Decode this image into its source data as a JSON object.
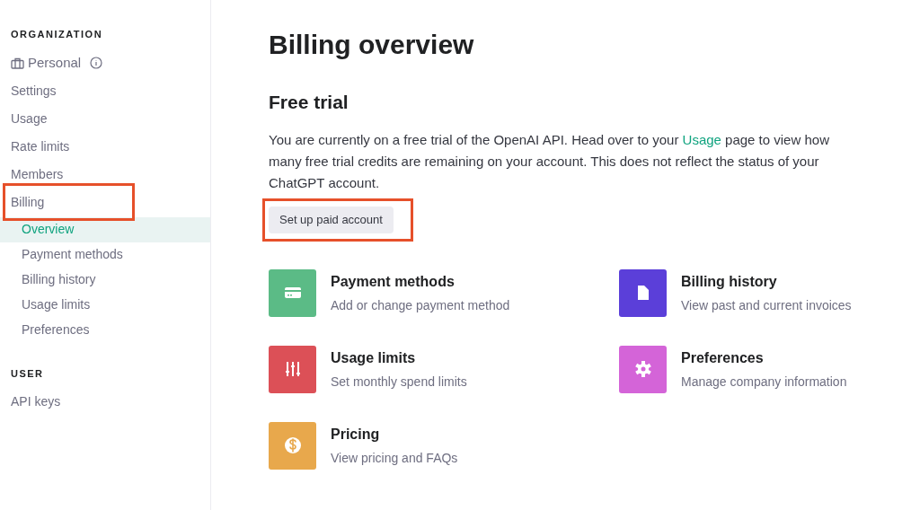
{
  "sidebar": {
    "sections": [
      {
        "heading": "ORGANIZATION",
        "items": [
          {
            "label": "Personal",
            "kind": "org"
          },
          {
            "label": "Settings",
            "kind": "link",
            "selected": false,
            "highlighted": false
          },
          {
            "label": "Usage",
            "kind": "link",
            "selected": false,
            "highlighted": false
          },
          {
            "label": "Rate limits",
            "kind": "link",
            "selected": false,
            "highlighted": false
          },
          {
            "label": "Members",
            "kind": "link",
            "selected": false,
            "highlighted": false
          },
          {
            "label": "Billing",
            "kind": "link",
            "selected": false,
            "highlighted": true,
            "children": [
              {
                "label": "Overview",
                "selected": true
              },
              {
                "label": "Payment methods",
                "selected": false
              },
              {
                "label": "Billing history",
                "selected": false
              },
              {
                "label": "Usage limits",
                "selected": false
              },
              {
                "label": "Preferences",
                "selected": false
              }
            ]
          }
        ]
      },
      {
        "heading": "USER",
        "items": [
          {
            "label": "API keys",
            "kind": "link",
            "selected": false,
            "highlighted": false
          }
        ]
      }
    ]
  },
  "main": {
    "title": "Billing overview",
    "section_title": "Free trial",
    "paragraph": "You are currently on a free trial of the OpenAI API. Head over to your ",
    "link": "Usage",
    "paragraph_end": " page to view how many free trial credits are remaining on your account. This does not reflect the status of your ChatGPT account.",
    "button": {
      "label": "Set up paid account",
      "highlighted": true
    },
    "cards": [
      {
        "title": "Payment methods",
        "subtitle": "Add or change payment method",
        "kind": "card",
        "color": "#5bbb86"
      },
      {
        "title": "Billing history",
        "subtitle": "View past and current invoices",
        "kind": "document",
        "color": "#5b3fd9"
      },
      {
        "title": "Usage limits",
        "subtitle": "Set monthly spend limits",
        "kind": "sliders",
        "color": "#dc5057"
      },
      {
        "title": "Preferences",
        "subtitle": "Manage company information",
        "kind": "gear",
        "color": "#d464d8"
      },
      {
        "title": "Pricing",
        "subtitle": "View pricing and FAQs",
        "kind": "dollar",
        "color": "#e8a84c"
      }
    ]
  }
}
